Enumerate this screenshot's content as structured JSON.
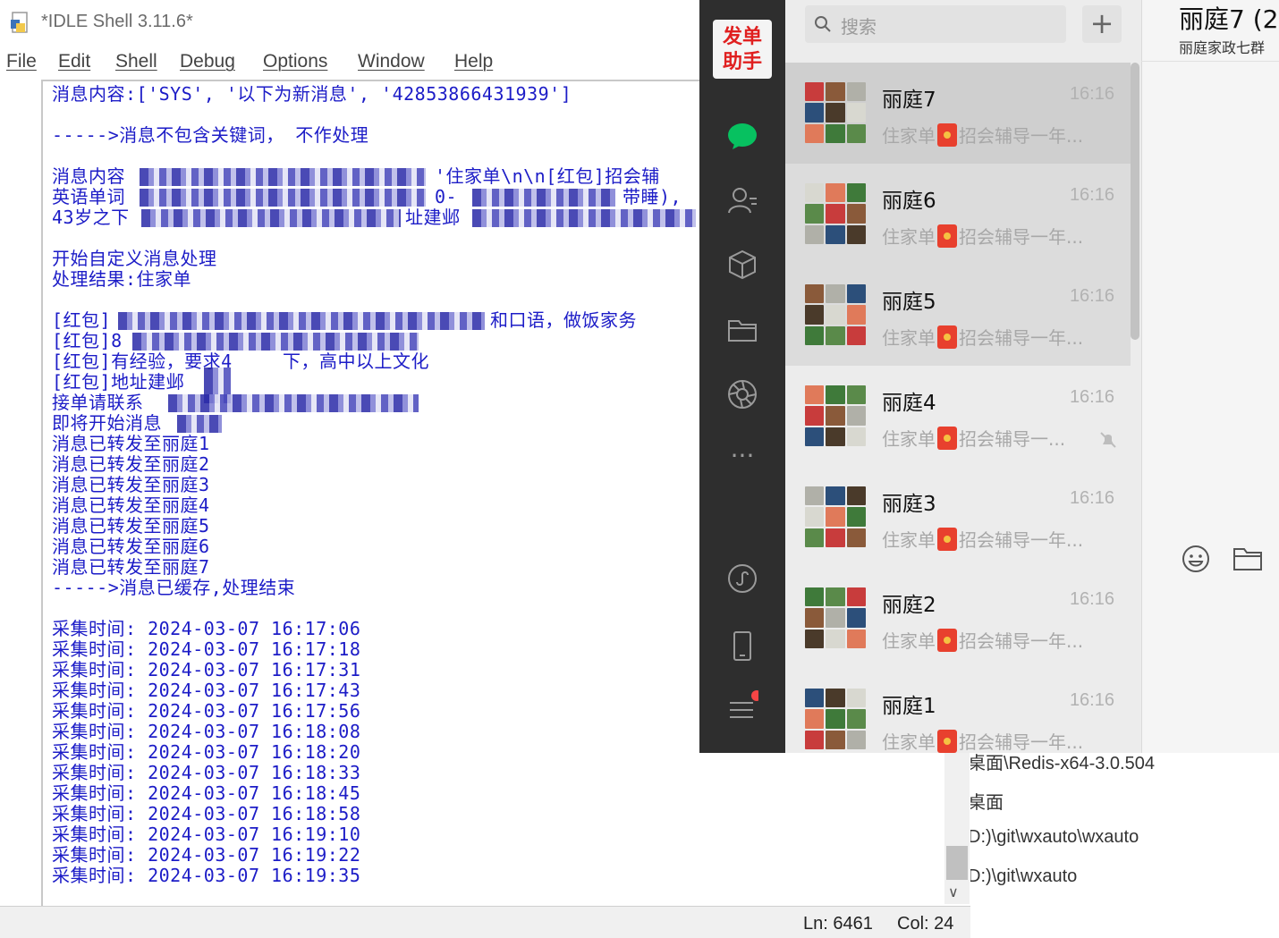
{
  "background_window": {
    "lines": [
      "桌面\\Redis-x64-3.0.504",
      "桌面",
      "D:)\\git\\wxauto\\wxauto",
      "D:)\\git\\wxauto"
    ]
  },
  "idle": {
    "title": "*IDLE Shell 3.11.6*",
    "menu": [
      "File",
      "Edit",
      "Shell",
      "Debug",
      "Options",
      "Window",
      "Help"
    ],
    "lines": [
      "消息内容:['SYS', '以下为新消息', '42853866431939']",
      "----->消息不包含关键词， 不作处理",
      "消息内容",
      "英语单词",
      "43岁之下",
      "开始自定义消息处理",
      "处理结果:住家单",
      "[红包]",
      "[红包]8",
      "[红包]有经验，要求4",
      "[红包]地址建邺",
      "接单请联系",
      "即将开始消息",
      "消息已转发至丽庭1",
      "消息已转发至丽庭2",
      "消息已转发至丽庭3",
      "消息已转发至丽庭4",
      "消息已转发至丽庭5",
      "消息已转发至丽庭6",
      "消息已转发至丽庭7",
      "----->消息已缓存,处理结束",
      "采集时间: 2024-03-07 16:17:06",
      "采集时间: 2024-03-07 16:17:18",
      "采集时间: 2024-03-07 16:17:31",
      "采集时间: 2024-03-07 16:17:43",
      "采集时间: 2024-03-07 16:17:56",
      "采集时间: 2024-03-07 16:18:08",
      "采集时间: 2024-03-07 16:18:20",
      "采集时间: 2024-03-07 16:18:33",
      "采集时间: 2024-03-07 16:18:45",
      "采集时间: 2024-03-07 16:18:58",
      "采集时间: 2024-03-07 16:19:10",
      "采集时间: 2024-03-07 16:19:22",
      "采集时间: 2024-03-07 16:19:35"
    ],
    "fragments": {
      "l3_tail": "'住家单\\n\\n[红包]招会辅",
      "l4_mid": "0-",
      "l4_tail": "带睡),",
      "l5_tail": "址建邺",
      "l8_tail": "和口语，做饭家务",
      "l10_tail": "下，高中以上文化"
    },
    "status": {
      "ln": "Ln: 6461",
      "col": "Col: 24"
    }
  },
  "wechat": {
    "app_label_1": "发单",
    "app_label_2": "助手",
    "search_placeholder": "搜索",
    "add_label": "+",
    "chats": [
      {
        "name": "丽庭7",
        "time": "16:16",
        "prefix": "住家单",
        "snippet": "招会辅导一年...",
        "muted": false
      },
      {
        "name": "丽庭6",
        "time": "16:16",
        "prefix": "住家单",
        "snippet": "招会辅导一年...",
        "muted": false
      },
      {
        "name": "丽庭5",
        "time": "16:16",
        "prefix": "住家单",
        "snippet": "招会辅导一年...",
        "muted": false
      },
      {
        "name": "丽庭4",
        "time": "16:16",
        "prefix": "住家单",
        "snippet": "招会辅导一...",
        "muted": true
      },
      {
        "name": "丽庭3",
        "time": "16:16",
        "prefix": "住家单",
        "snippet": "招会辅导一年...",
        "muted": false
      },
      {
        "name": "丽庭2",
        "time": "16:16",
        "prefix": "住家单",
        "snippet": "招会辅导一年...",
        "muted": false
      },
      {
        "name": "丽庭1",
        "time": "16:16",
        "prefix": "住家单",
        "snippet": "招会辅导一年...",
        "muted": false
      }
    ],
    "chat_title": "丽庭7 (2",
    "chat_subtitle": "丽庭家政七群",
    "colors": {
      "sidebar": "#2e2e2e",
      "active_chat_icon": "#07c160",
      "list_bg": "#ececec",
      "selected": "#cfcfcf"
    }
  }
}
